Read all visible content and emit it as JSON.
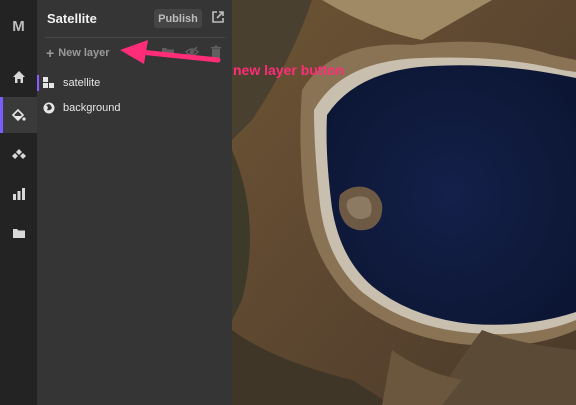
{
  "app": {
    "logo": "M"
  },
  "rail": {
    "items": [
      {
        "name": "home-icon"
      },
      {
        "name": "paint-bucket-icon",
        "active": true
      },
      {
        "name": "sources-icon"
      },
      {
        "name": "chart-icon"
      },
      {
        "name": "folder-icon"
      }
    ]
  },
  "panel": {
    "title": "Satellite",
    "publish_label": "Publish",
    "new_layer_label": "New layer",
    "layers": [
      {
        "label": "satellite",
        "icon": "raster-icon",
        "selected": true
      },
      {
        "label": "background",
        "icon": "background-globe-icon",
        "selected": false
      }
    ]
  },
  "annotation": {
    "text": "new layer button",
    "color": "#ff2d78"
  },
  "colors": {
    "accent": "#7a5cff",
    "lake": "#0f1a3a",
    "terrain": "#6a5436"
  }
}
